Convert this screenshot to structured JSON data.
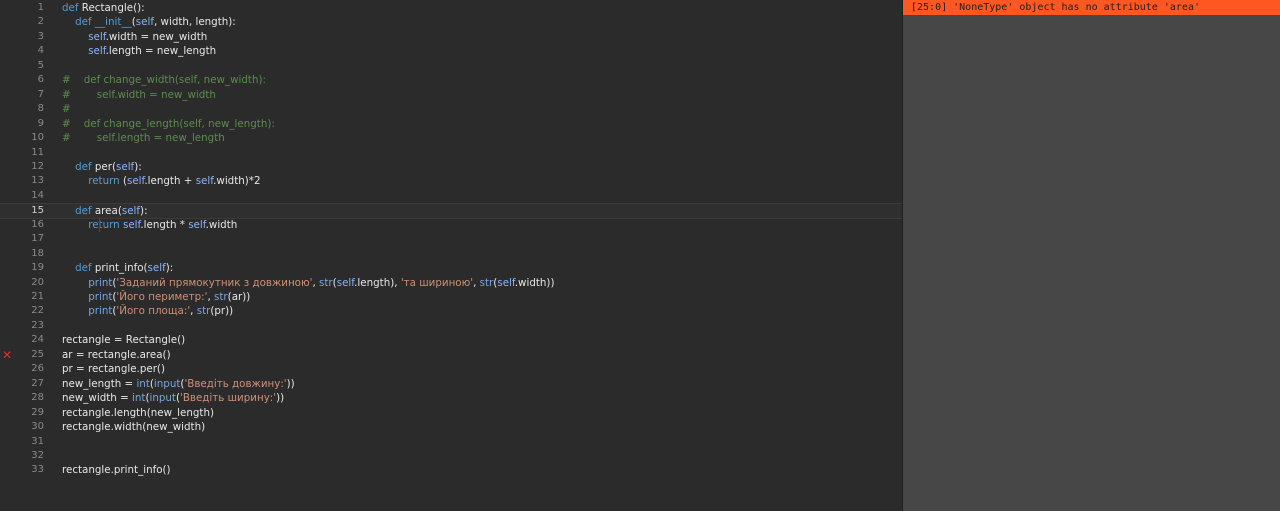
{
  "colors": {
    "editor_bg": "#2b2b2b",
    "panel_bg": "#474747",
    "error_bar": "#ff5722",
    "keyword": "#569cd6",
    "string": "#ce9178",
    "comment": "#5c8c4c",
    "error_marker": "#e02c2c"
  },
  "editor": {
    "active_line": 15,
    "error_line": 25,
    "lines": [
      {
        "n": "1",
        "segs": [
          [
            "kw",
            "def"
          ],
          [
            "t",
            " Rectangle():"
          ]
        ]
      },
      {
        "n": "2",
        "segs": [
          [
            "t",
            "    "
          ],
          [
            "kw",
            "def"
          ],
          [
            "t",
            " "
          ],
          [
            "kw",
            "__init__"
          ],
          [
            "t",
            "("
          ],
          [
            "self",
            "self"
          ],
          [
            "t",
            ", width, length):"
          ]
        ]
      },
      {
        "n": "3",
        "segs": [
          [
            "t",
            "        "
          ],
          [
            "self",
            "self"
          ],
          [
            "t",
            ".width = new_width"
          ]
        ]
      },
      {
        "n": "4",
        "segs": [
          [
            "t",
            "        "
          ],
          [
            "self",
            "self"
          ],
          [
            "t",
            ".length = new_length"
          ]
        ]
      },
      {
        "n": "5",
        "segs": []
      },
      {
        "n": "6",
        "segs": [
          [
            "com",
            "#    def change_width(self, new_width):"
          ]
        ]
      },
      {
        "n": "7",
        "segs": [
          [
            "com",
            "#        self.width = new_width"
          ]
        ]
      },
      {
        "n": "8",
        "segs": [
          [
            "com",
            "#"
          ]
        ]
      },
      {
        "n": "9",
        "segs": [
          [
            "com",
            "#    def change_length(self, new_length):"
          ]
        ]
      },
      {
        "n": "10",
        "segs": [
          [
            "com",
            "#        self.length = new_length"
          ]
        ]
      },
      {
        "n": "11",
        "segs": []
      },
      {
        "n": "12",
        "segs": [
          [
            "t",
            "    "
          ],
          [
            "kw",
            "def"
          ],
          [
            "t",
            " per("
          ],
          [
            "self",
            "self"
          ],
          [
            "t",
            "):"
          ]
        ]
      },
      {
        "n": "13",
        "segs": [
          [
            "t",
            "        "
          ],
          [
            "kw",
            "return"
          ],
          [
            "t",
            " ("
          ],
          [
            "self",
            "self"
          ],
          [
            "t",
            ".length + "
          ],
          [
            "self",
            "self"
          ],
          [
            "t",
            ".width)*2"
          ]
        ]
      },
      {
        "n": "14",
        "segs": []
      },
      {
        "n": "15",
        "segs": [
          [
            "t",
            "    "
          ],
          [
            "kw",
            "def"
          ],
          [
            "t",
            " area("
          ],
          [
            "self",
            "self"
          ],
          [
            "t",
            "):"
          ]
        ]
      },
      {
        "n": "16",
        "segs": [
          [
            "t",
            "        "
          ],
          [
            "kw",
            "return"
          ],
          [
            "t",
            " "
          ],
          [
            "self",
            "self"
          ],
          [
            "t",
            ".length * "
          ],
          [
            "self",
            "self"
          ],
          [
            "t",
            ".width"
          ]
        ]
      },
      {
        "n": "17",
        "segs": []
      },
      {
        "n": "18",
        "segs": []
      },
      {
        "n": "19",
        "segs": [
          [
            "t",
            "    "
          ],
          [
            "kw",
            "def"
          ],
          [
            "t",
            " print_info("
          ],
          [
            "self",
            "self"
          ],
          [
            "t",
            "):"
          ]
        ]
      },
      {
        "n": "20",
        "segs": [
          [
            "t",
            "        "
          ],
          [
            "bi",
            "print"
          ],
          [
            "t",
            "("
          ],
          [
            "str",
            "'Заданий прямокутник з довжиною'"
          ],
          [
            "t",
            ", "
          ],
          [
            "bi",
            "str"
          ],
          [
            "t",
            "("
          ],
          [
            "self",
            "self"
          ],
          [
            "t",
            ".length), "
          ],
          [
            "str",
            "'та шириною'"
          ],
          [
            "t",
            ", "
          ],
          [
            "bi",
            "str"
          ],
          [
            "t",
            "("
          ],
          [
            "self",
            "self"
          ],
          [
            "t",
            ".width))"
          ]
        ]
      },
      {
        "n": "21",
        "segs": [
          [
            "t",
            "        "
          ],
          [
            "bi",
            "print"
          ],
          [
            "t",
            "("
          ],
          [
            "str",
            "'Його периметр:'"
          ],
          [
            "t",
            ", "
          ],
          [
            "bi",
            "str"
          ],
          [
            "t",
            "(ar))"
          ]
        ]
      },
      {
        "n": "22",
        "segs": [
          [
            "t",
            "        "
          ],
          [
            "bi",
            "print"
          ],
          [
            "t",
            "("
          ],
          [
            "str",
            "'Його площа:'"
          ],
          [
            "t",
            ", "
          ],
          [
            "bi",
            "str"
          ],
          [
            "t",
            "(pr))"
          ]
        ]
      },
      {
        "n": "23",
        "segs": []
      },
      {
        "n": "24",
        "segs": [
          [
            "t",
            "rectangle = Rectangle()"
          ]
        ]
      },
      {
        "n": "25",
        "segs": [
          [
            "t",
            "ar = rectangle.area()"
          ]
        ]
      },
      {
        "n": "26",
        "segs": [
          [
            "t",
            "pr = rectangle.per()"
          ]
        ]
      },
      {
        "n": "27",
        "segs": [
          [
            "t",
            "new_length = "
          ],
          [
            "bi",
            "int"
          ],
          [
            "t",
            "("
          ],
          [
            "bi",
            "input"
          ],
          [
            "t",
            "("
          ],
          [
            "str",
            "'Введіть довжину:'"
          ],
          [
            "t",
            "))"
          ]
        ]
      },
      {
        "n": "28",
        "segs": [
          [
            "t",
            "new_width = "
          ],
          [
            "bi",
            "int"
          ],
          [
            "t",
            "("
          ],
          [
            "bi",
            "input"
          ],
          [
            "t",
            "("
          ],
          [
            "str",
            "'Введіть ширину:'"
          ],
          [
            "t",
            "))"
          ]
        ]
      },
      {
        "n": "29",
        "segs": [
          [
            "t",
            "rectangle.length(new_length)"
          ]
        ]
      },
      {
        "n": "30",
        "segs": [
          [
            "t",
            "rectangle.width(new_width)"
          ]
        ]
      },
      {
        "n": "31",
        "segs": []
      },
      {
        "n": "32",
        "segs": []
      },
      {
        "n": "33",
        "segs": [
          [
            "t",
            "rectangle.print_info()"
          ]
        ]
      }
    ]
  },
  "error_panel": {
    "message": "[25:0] 'NoneType' object has no attribute 'area'",
    "marker_icon": "error-x-icon",
    "marker_glyph": "✕"
  }
}
